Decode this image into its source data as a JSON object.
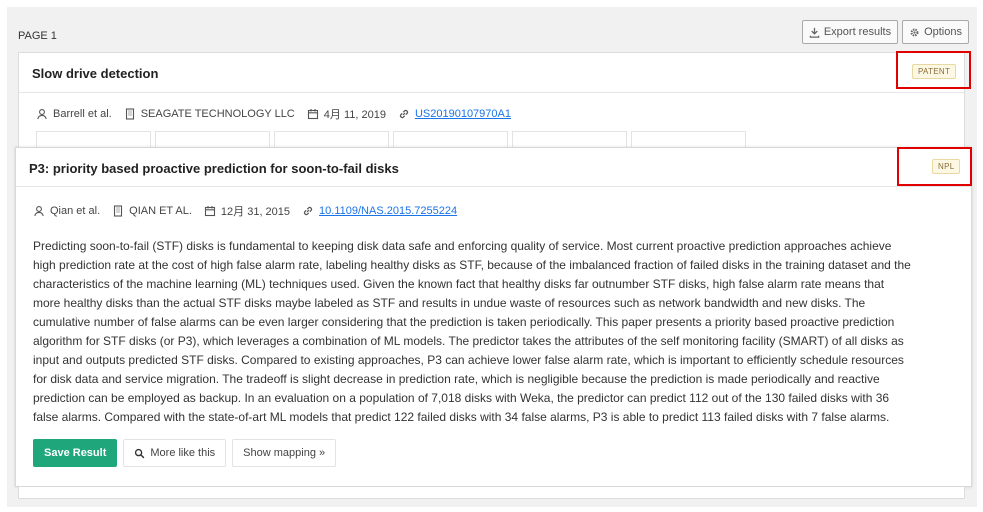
{
  "header": {
    "page_label": "PAGE 1",
    "export_label": "Export results",
    "options_label": "Options"
  },
  "result1": {
    "title": "Slow drive detection",
    "badge": "PATENT",
    "author": "Barrell et al.",
    "org": "SEAGATE TECHNOLOGY LLC",
    "date": "4月 11, 2019",
    "link": "US20190107970A1"
  },
  "result2": {
    "title": "P3: priority based proactive prediction for soon-to-fail disks",
    "badge": "NPL",
    "author": "Qian et al.",
    "org": "QIAN ET AL.",
    "date": "12月 31, 2015",
    "link": "10.1109/NAS.2015.7255224",
    "abstract_lines": [
      "Predicting soon-to-fail (STF) disks is fundamental to keeping disk data safe and enforcing quality of service. Most current proactive prediction approaches achieve",
      "high prediction rate at the cost of high false alarm rate, labeling healthy disks as STF, because of the imbalanced fraction of failed disks in the training dataset and the",
      "characteristics of the machine learning (ML) techniques used. Given the known fact that healthy disks far outnumber STF disks, high false alarm rate means that",
      "more healthy disks than the actual STF disks maybe labeled as STF and results in undue waste of resources such as network bandwidth and new disks. The",
      "cumulative number of false alarms can be even larger considering that the prediction is taken periodically. This paper presents a priority based proactive prediction",
      "algorithm for STF disks (or P3), which leverages a combination of ML models. The predictor takes the attributes of the self monitoring facility (SMART) of all disks as",
      "input and outputs predicted STF disks. Compared to existing approaches, P3 can achieve lower false alarm rate, which is important to efficiently schedule resources",
      "for disk data and service migration. The tradeoff is slight decrease in prediction rate, which is negligible because the prediction is made periodically and reactive",
      "prediction can be employed as backup. In an evaluation on a population of 7,018 disks with Weka, the predictor can predict 112 out of the 130 failed disks with 36",
      "false alarms. Compared with the state-of-art ML models that predict 122 failed disks with 34 false alarms, P3 is able to predict 113 failed disks with 7 false alarms."
    ],
    "save_label": "Save Result",
    "more_label": "More like this",
    "mapping_label": "Show mapping »"
  },
  "colors": {
    "accent_green": "#1fa67a",
    "highlight_red": "#e00000",
    "link_blue": "#1a73e8"
  }
}
